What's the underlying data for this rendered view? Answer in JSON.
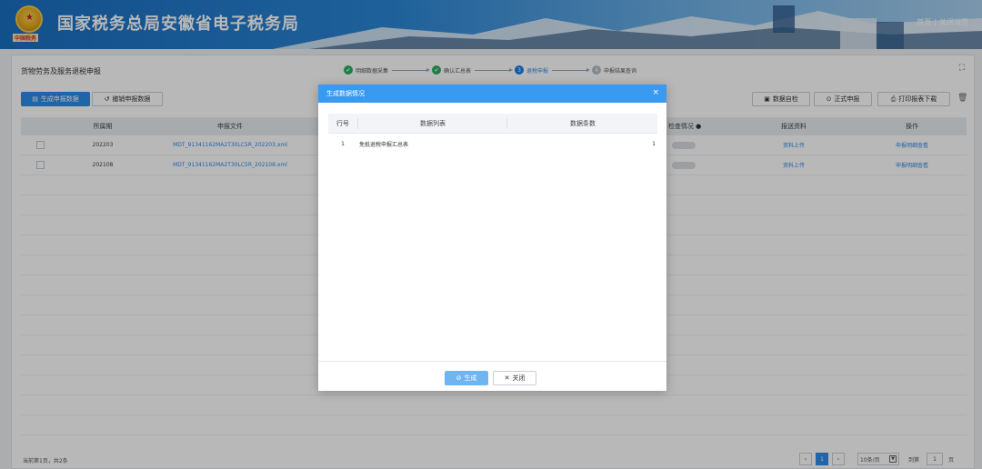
{
  "header": {
    "title": "国家税务总局安徽省电子税务局",
    "slogan": "中国税务",
    "links": [
      "首页",
      "关闭当页"
    ]
  },
  "panel": {
    "title": "货物劳务及服务退税申报",
    "steps": [
      {
        "label": "明细数据采集",
        "state": "done",
        "mark": "✔"
      },
      {
        "label": "确认汇总表",
        "state": "done",
        "mark": "✔"
      },
      {
        "label": "退税申报",
        "state": "active",
        "mark": "3"
      },
      {
        "label": "申报结果查询",
        "state": "todo",
        "mark": "4"
      }
    ],
    "toolbar": {
      "generate_label": "生成申报数据",
      "revoke_label": "撤销申报数据",
      "self_check_label": "数据自检",
      "formal_label": "正式申报",
      "print_label": "打印报表下载"
    },
    "table": {
      "headers": [
        "所属期",
        "申报文件",
        "检查情况",
        "报送资料",
        "操作"
      ],
      "rows": [
        {
          "period": "202203",
          "file": "MDT_91341162MA2T30LC5R_202203.xml",
          "upload": "资料上传",
          "action": "申报明细查看"
        },
        {
          "period": "202108",
          "file": "MDT_91341162MA2T30LC5R_202108.xml",
          "upload": "资料上传",
          "action": "申报明细查看"
        }
      ]
    },
    "footer": {
      "summary": "当前第1页，共2条",
      "page": "1",
      "page_size": "10条/页",
      "goto_label": "到第",
      "goto_value": "1",
      "page_unit": "页"
    }
  },
  "modal": {
    "title": "生成数据情况",
    "headers": [
      "行号",
      "数据列表",
      "数据条数"
    ],
    "rows": [
      {
        "no": "1",
        "name": "免抵退税申报汇总表",
        "count": "1"
      }
    ],
    "generate_label": "生成",
    "close_label": "关闭"
  },
  "colors": {
    "accent": "#2d8ce8",
    "header": "#1a6fc2",
    "success": "#27ae60"
  }
}
